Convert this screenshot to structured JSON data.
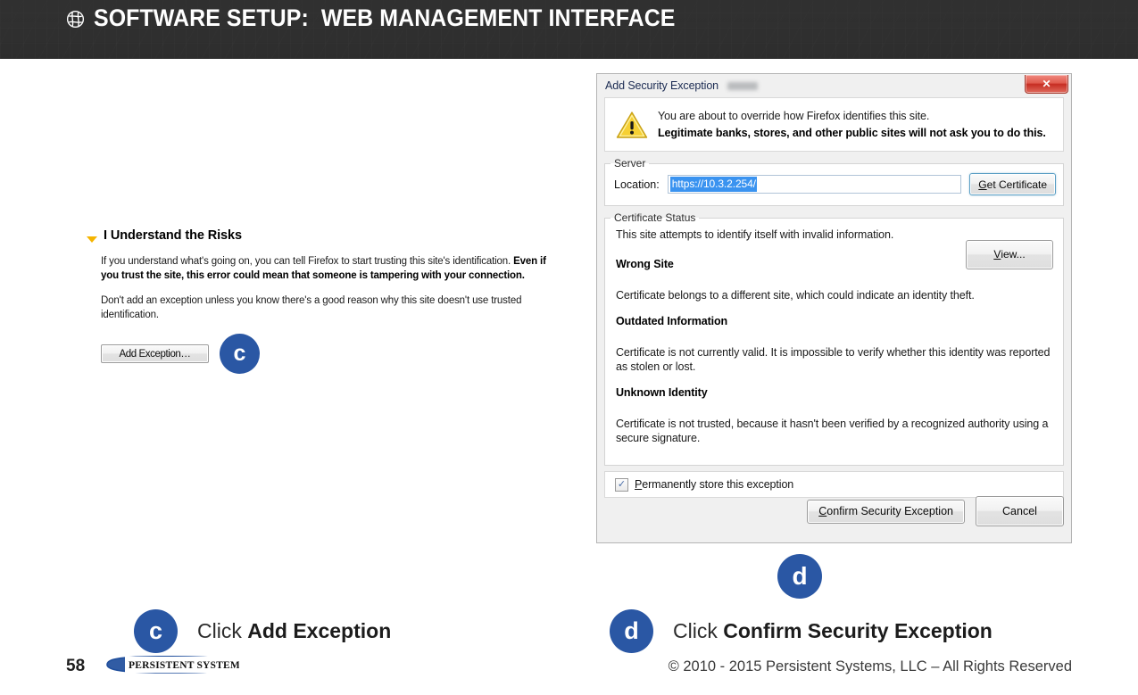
{
  "header": {
    "logo_icon": "persistent-knot-logo-icon",
    "title": "SOFTWARE SETUP:  WEB MANAGEMENT INTERFACE"
  },
  "firefox_warning": {
    "twisty_icon": "triangle-down-icon",
    "heading": "I Understand the Risks",
    "paragraph1_normal": "If you understand what's going on, you can tell Firefox to start trusting this site's identification. ",
    "paragraph1_bold": "Even if you trust the site, this error could mean that someone is tampering with your connection.",
    "paragraph2": "Don't add an exception unless you know there's a good reason why this site doesn't use trusted identification.",
    "add_exception_button": "Add Exception…",
    "callout_letter": "c"
  },
  "dialog": {
    "title": "Add Security Exception",
    "close_icon": "close-x-icon",
    "warning_icon": "warning-triangle-icon",
    "warning_line1": "You are about to override how Firefox identifies this site.",
    "warning_line2": "Legitimate banks, stores, and other public sites will not ask you to do this.",
    "server": {
      "legend": "Server",
      "location_label": "Location:",
      "location_value": "https://10.3.2.254/",
      "location_placeholder": "https://",
      "get_certificate_button_accel": "G",
      "get_certificate_button_rest": "et Certificate"
    },
    "certificate_status": {
      "legend": "Certificate Status",
      "intro": "This site attempts to identify itself with invalid information.",
      "view_button_accel": "V",
      "view_button_rest": "iew...",
      "sections": [
        {
          "heading": "Wrong Site",
          "body": "Certificate belongs to a different site, which could indicate an identity theft."
        },
        {
          "heading": "Outdated Information",
          "body": "Certificate is not currently valid. It is impossible to verify whether this identity was reported as stolen or lost."
        },
        {
          "heading": "Unknown Identity",
          "body": "Certificate is not trusted, because it hasn't been verified by a recognized authority using a secure signature."
        }
      ]
    },
    "permanent_checkbox": {
      "checked": true,
      "check_glyph": "✓",
      "label_accel": "P",
      "label_rest": "ermanently store this exception"
    },
    "confirm_button_accel": "C",
    "confirm_button_rest": "onfirm Security Exception",
    "cancel_button": "Cancel",
    "callout_letter": "d"
  },
  "captions": [
    {
      "letter": "c",
      "prefix": "Click ",
      "bold": "Add Exception"
    },
    {
      "letter": "d",
      "prefix": "Click ",
      "bold": "Confirm Security Exception"
    }
  ],
  "footer": {
    "page_number": "58",
    "logo_text": "PERSISTENT SYSTEMS",
    "copyright": "© 2010 - 2015 Persistent Systems, LLC – All Rights Reserved"
  },
  "colors": {
    "header_bg": "#303030",
    "callout_blue": "#2a57a4",
    "twisty_yellow": "#f5b400",
    "selection_blue": "#3a93f0",
    "logo_blue": "#1f4e9c"
  }
}
